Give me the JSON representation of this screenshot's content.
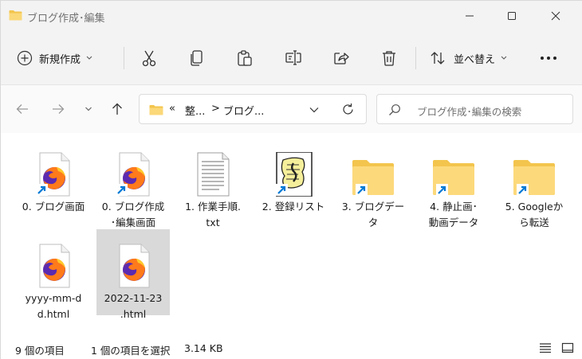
{
  "window": {
    "title": "ブログ作成･編集",
    "icon": "folder-icon"
  },
  "toolbar": {
    "new_label": "新規作成",
    "sort_label": "並べ替え",
    "buttons": [
      "cut-icon",
      "copy-icon",
      "paste-icon",
      "rename-icon",
      "share-icon",
      "delete-icon"
    ]
  },
  "address": {
    "overflow": "«",
    "crumb_1": "整...",
    "separator": ">",
    "crumb_2": "ブログ..."
  },
  "search": {
    "placeholder": "ブログ作成･編集の検索"
  },
  "files": [
    {
      "label": "0. ブログ画面",
      "type": "html-shortcut",
      "icon": "firefox-html-shortcut-icon"
    },
    {
      "label": "0. ブログ作成\n･編集画面",
      "type": "html-shortcut",
      "icon": "firefox-html-shortcut-icon"
    },
    {
      "label": "1. 作業手順.\ntxt",
      "type": "txt",
      "icon": "text-file-icon"
    },
    {
      "label": "2. 登録リスト",
      "type": "list-shortcut",
      "icon": "list-shortcut-icon"
    },
    {
      "label": "3. ブログデー\nタ",
      "type": "folder-shortcut",
      "icon": "folder-shortcut-icon"
    },
    {
      "label": "4. 静止画･\n動画データ",
      "type": "folder-shortcut",
      "icon": "folder-shortcut-icon"
    },
    {
      "label": "5. Googleか\nら転送",
      "type": "folder-shortcut",
      "icon": "folder-shortcut-icon"
    },
    {
      "label": "yyyy-mm-d\nd.html",
      "type": "html",
      "icon": "firefox-html-icon"
    },
    {
      "label": "2022-11-23\n.html",
      "type": "html",
      "icon": "firefox-html-icon",
      "selected": true
    }
  ],
  "status": {
    "count": "9 個の項目",
    "selection": "1 個の項目を選択",
    "size": "3.14 KB"
  },
  "colors": {
    "accent": "#0078d4",
    "folder": "#f8d775",
    "selection": "#d9d9d9"
  }
}
